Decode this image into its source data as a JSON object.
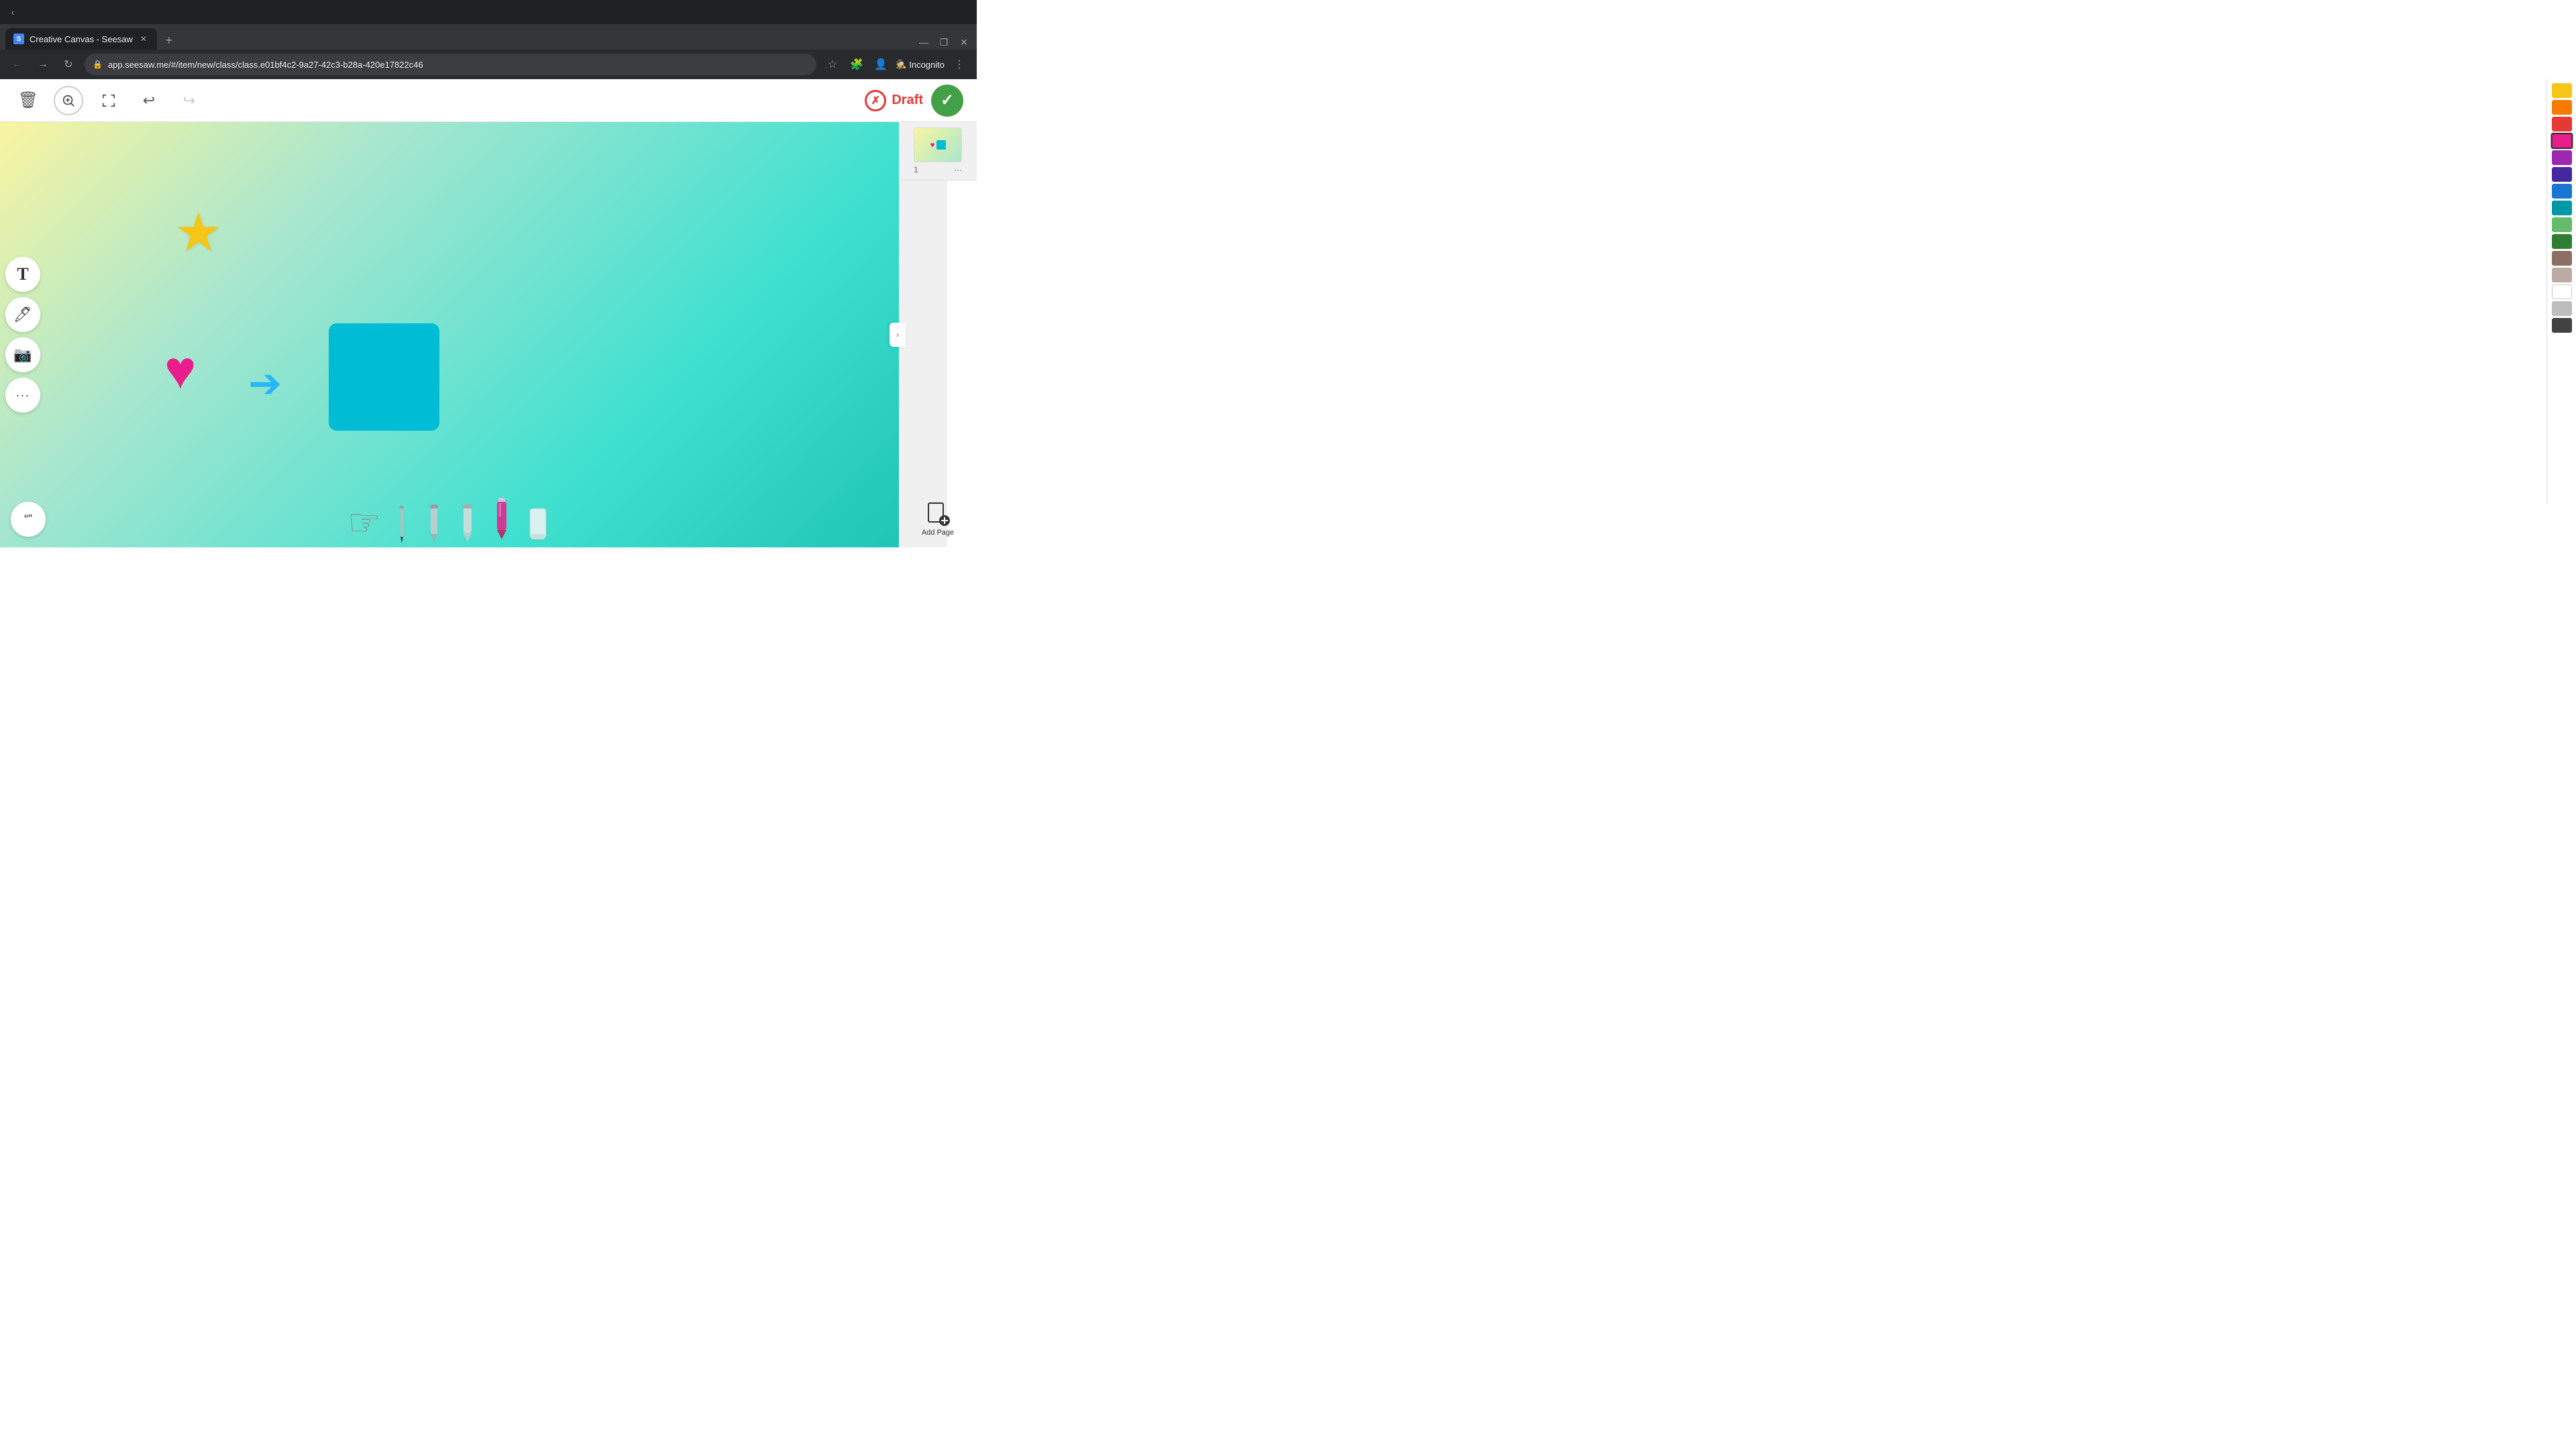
{
  "browser": {
    "tab_title": "Creative Canvas - Seesaw",
    "tab_favicon": "S",
    "url": "app.seesaw.me/#/item/new/class/class.e01bf4c2-9a27-42c3-b28a-420e17822c46",
    "new_tab_label": "+",
    "incognito_label": "Incognito",
    "window_minimize": "—",
    "window_maximize": "❐",
    "window_close": "✕"
  },
  "toolbar": {
    "delete_label": "🗑",
    "zoom_in_label": "+",
    "fullscreen_label": "⛶",
    "undo_label": "↩",
    "redo_label": "↪",
    "draft_label": "Draft",
    "submit_label": "✓"
  },
  "left_tools": {
    "text_label": "T",
    "pen_label": "✏",
    "camera_label": "📷",
    "more_label": "···"
  },
  "canvas": {
    "background_gradient_start": "#f9f5a0",
    "background_gradient_end": "#20c5b5"
  },
  "colors": [
    {
      "name": "yellow",
      "hex": "#f5c518"
    },
    {
      "name": "orange",
      "hex": "#f57c00"
    },
    {
      "name": "red",
      "hex": "#e53935"
    },
    {
      "name": "magenta",
      "hex": "#e91e8c",
      "active": true
    },
    {
      "name": "purple",
      "hex": "#7b1fa2"
    },
    {
      "name": "dark-purple",
      "hex": "#4527a0"
    },
    {
      "name": "blue",
      "hex": "#1976d2"
    },
    {
      "name": "cyan",
      "hex": "#0097a7"
    },
    {
      "name": "light-green",
      "hex": "#81c784"
    },
    {
      "name": "green",
      "hex": "#388e3c"
    },
    {
      "name": "brown",
      "hex": "#6d4c41"
    },
    {
      "name": "light-brown",
      "hex": "#bcaaa4"
    },
    {
      "name": "white",
      "hex": "#ffffff"
    },
    {
      "name": "light-gray",
      "hex": "#bdbdbd"
    },
    {
      "name": "dark-gray",
      "hex": "#424242"
    }
  ],
  "page_thumbnail": {
    "page_number": "1",
    "more_label": "···"
  },
  "bottom_tools": {
    "cursor_label": "☞",
    "pencil_label": "pencil",
    "marker_label": "marker",
    "highlighter_label": "highlighter",
    "pink_marker_label": "pink-marker",
    "eraser_label": "eraser"
  },
  "add_page": {
    "label": "Add Page"
  },
  "quote_tool": {
    "label": "“”"
  }
}
